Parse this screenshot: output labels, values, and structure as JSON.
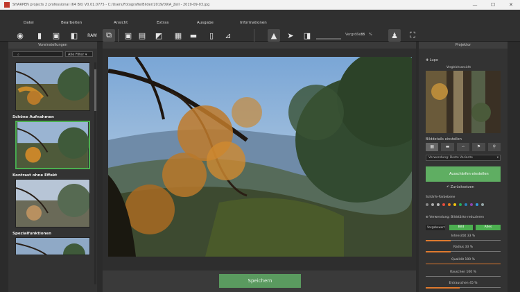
{
  "window": {
    "title": "SHARPEN projects 2 professional (64 Bit)   V0.01.0775 - C:/Users/Fotografie/Bilder/2019/09/A_Zell - 2019-09-03.jpg",
    "minimize": "—",
    "maximize": "☐",
    "close": "✕"
  },
  "menu": [
    {
      "label": "Datei"
    },
    {
      "label": "Bearbeiten"
    },
    {
      "label": "Ansicht"
    },
    {
      "label": "Extras"
    },
    {
      "label": "Ausgabe"
    },
    {
      "label": "Informationen"
    }
  ],
  "toolbar": {
    "zoom_label": "Vergrößern",
    "zoom_value": "33",
    "zoom_unit": "%"
  },
  "left_panel": {
    "header": "Voreinstellungen",
    "search_placeholder": "",
    "filter_value": "Alle Filter",
    "presets": [
      {
        "label": ""
      },
      {
        "label": "Schöne Aufnahmen"
      },
      {
        "label": "Kontrast ohne Effekt"
      },
      {
        "label": "Spezialfunktionen"
      }
    ]
  },
  "main": {
    "save_label": "Speichern"
  },
  "right_panel": {
    "header": "Projektor",
    "section_lupe": "Lupe",
    "navigator_label": "Vergleichsansicht",
    "section_sharp": "Bilddetails einstellen",
    "sharp_select": "Verwendung: Beste Variante",
    "green_button": "Ausschärfen einstellen",
    "reset_label": "Zurücksetzen",
    "color_section": "Schärfe-Farbebene",
    "protect_section": "Verwendung: Bildstärke reduzieren",
    "mode_label": "Vorgabewert",
    "mode_btn1": "Bild",
    "mode_btn2": "Alles",
    "sliders": [
      {
        "label": "Intensität",
        "value": "33",
        "unit": "%",
        "level": 0.33
      },
      {
        "label": "Radius",
        "value": "33",
        "unit": "%",
        "level": 0.33
      },
      {
        "label": "Qualität",
        "value": "100",
        "unit": "%",
        "level": 0.0
      },
      {
        "label": "Rauschen",
        "value": "100",
        "unit": "%",
        "level": 0.0
      },
      {
        "label": "Entrauschen",
        "value": "45",
        "unit": "%",
        "level": 0.45
      }
    ],
    "dot_colors": [
      "#888",
      "#aaa",
      "#bbb",
      "#e74c3c",
      "#e67e22",
      "#f1c40f",
      "#27ae60",
      "#2980b9",
      "#8e44ad",
      "#3498db",
      "#95a5a6"
    ]
  },
  "colors": {
    "accent_green": "#5a9a5f",
    "selection_green": "#4caf50",
    "slider_orange": "#e07a2e"
  }
}
